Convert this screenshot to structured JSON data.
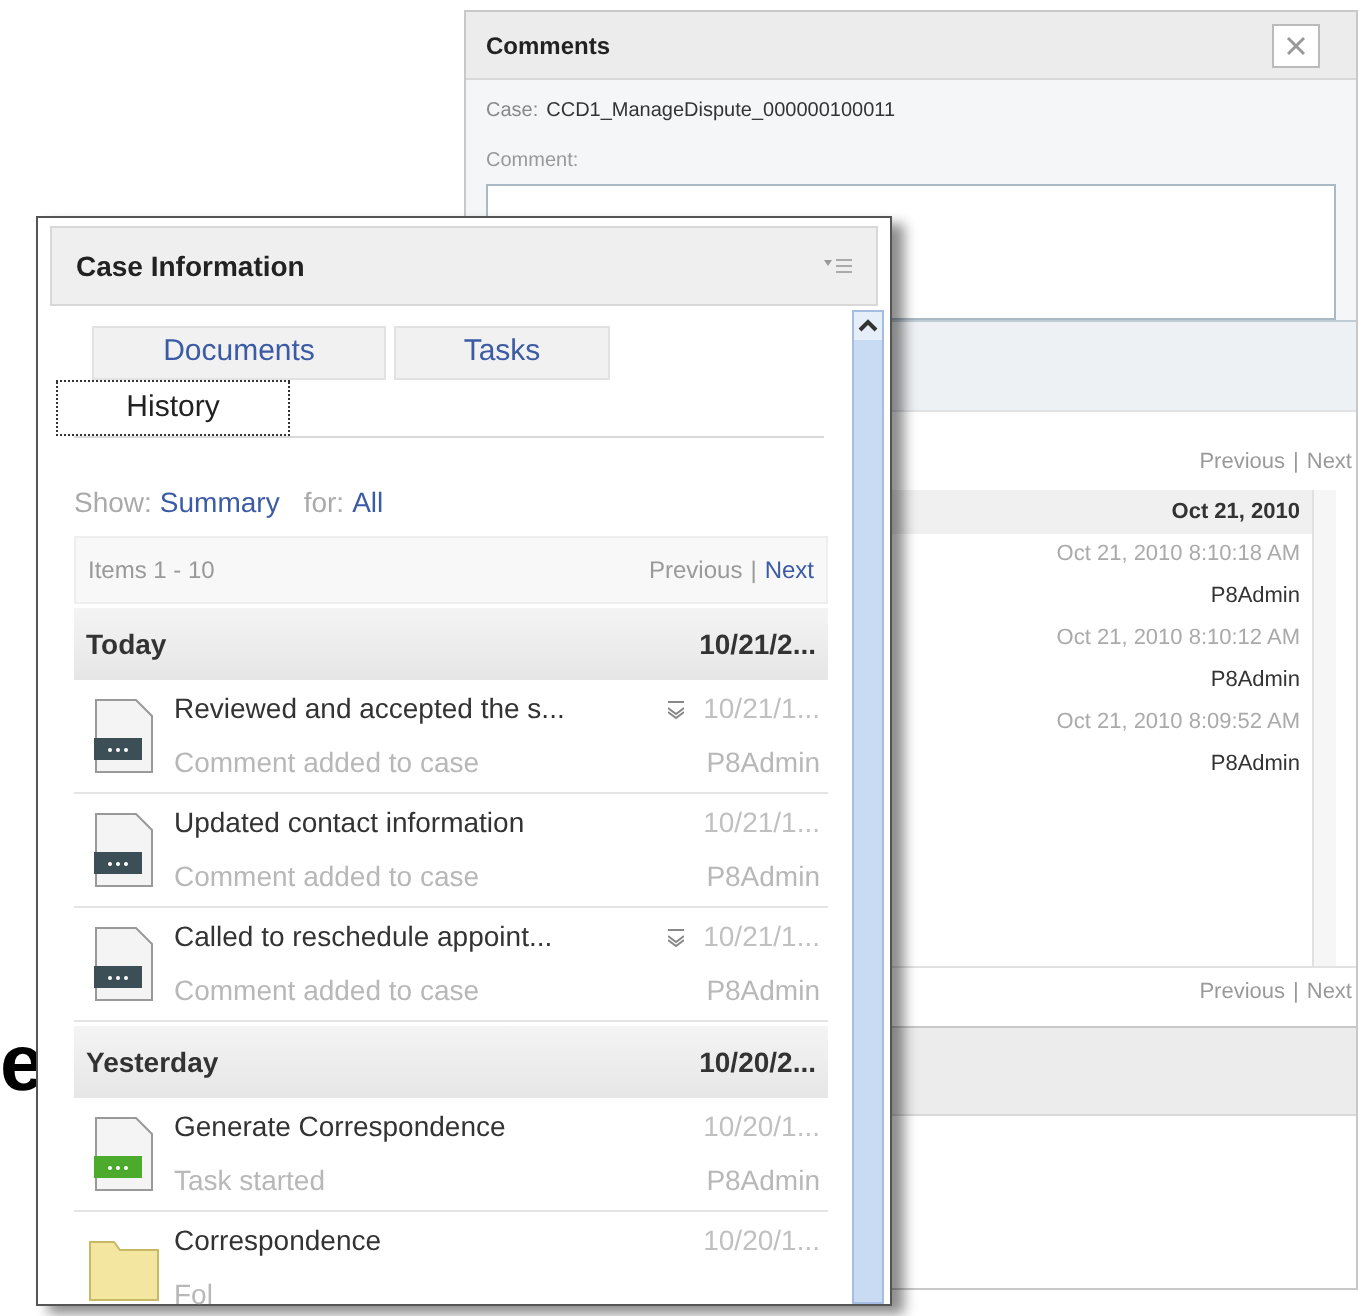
{
  "comments_panel": {
    "title": "Comments",
    "case_label": "Case:",
    "case_value": "CCD1_ManageDispute_000000100011",
    "comment_label": "Comment:",
    "pager_top": {
      "previous": {
        "label": "Previous",
        "disabled": true
      },
      "separator": "|",
      "next": {
        "label": "Next",
        "disabled": true
      }
    },
    "group_date": "Oct 21, 2010",
    "entries": [
      {
        "time": "Oct 21, 2010 8:10:18 AM",
        "user": "P8Admin"
      },
      {
        "time": "Oct 21, 2010 8:10:12 AM",
        "user": "P8Admin"
      },
      {
        "time": "Oct 21, 2010 8:09:52 AM",
        "user": "P8Admin"
      }
    ],
    "pager_bottom": {
      "previous": {
        "label": "Previous",
        "disabled": true
      },
      "separator": "|",
      "next": {
        "label": "Next",
        "disabled": true
      }
    }
  },
  "background_text": "e",
  "case_panel": {
    "title": "Case Information",
    "tabs": [
      {
        "label": "Documents",
        "selected": false
      },
      {
        "label": "Tasks",
        "selected": false
      },
      {
        "label": "History",
        "selected": true
      }
    ],
    "show_label": "Show:",
    "show_value": "Summary",
    "for_label": "for:",
    "for_value": "All",
    "items_range": "Items 1 - 10",
    "pager": {
      "previous": {
        "label": "Previous",
        "disabled": true
      },
      "separator": "|",
      "next": {
        "label": "Next",
        "disabled": false
      }
    },
    "groups": [
      {
        "label": "Today",
        "date": "10/21/2...",
        "rows": [
          {
            "kind": "comment",
            "title": "Reviewed and accepted the s...",
            "expandable": true,
            "date": "10/21/1...",
            "subtitle": "Comment added to case",
            "user": "P8Admin"
          },
          {
            "kind": "comment",
            "title": "Updated contact information",
            "expandable": false,
            "date": "10/21/1...",
            "subtitle": "Comment added to case",
            "user": "P8Admin"
          },
          {
            "kind": "comment",
            "title": "Called to reschedule appoint...",
            "expandable": true,
            "date": "10/21/1...",
            "subtitle": "Comment added to case",
            "user": "P8Admin"
          }
        ]
      },
      {
        "label": "Yesterday",
        "date": "10/20/2...",
        "rows": [
          {
            "kind": "task",
            "title": "Generate Correspondence",
            "expandable": false,
            "date": "10/20/1...",
            "subtitle": "Task started",
            "user": "P8Admin"
          },
          {
            "kind": "folder",
            "title": "Correspondence",
            "expandable": false,
            "date": "10/20/1...",
            "subtitle": "Fol"
          }
        ]
      }
    ]
  }
}
